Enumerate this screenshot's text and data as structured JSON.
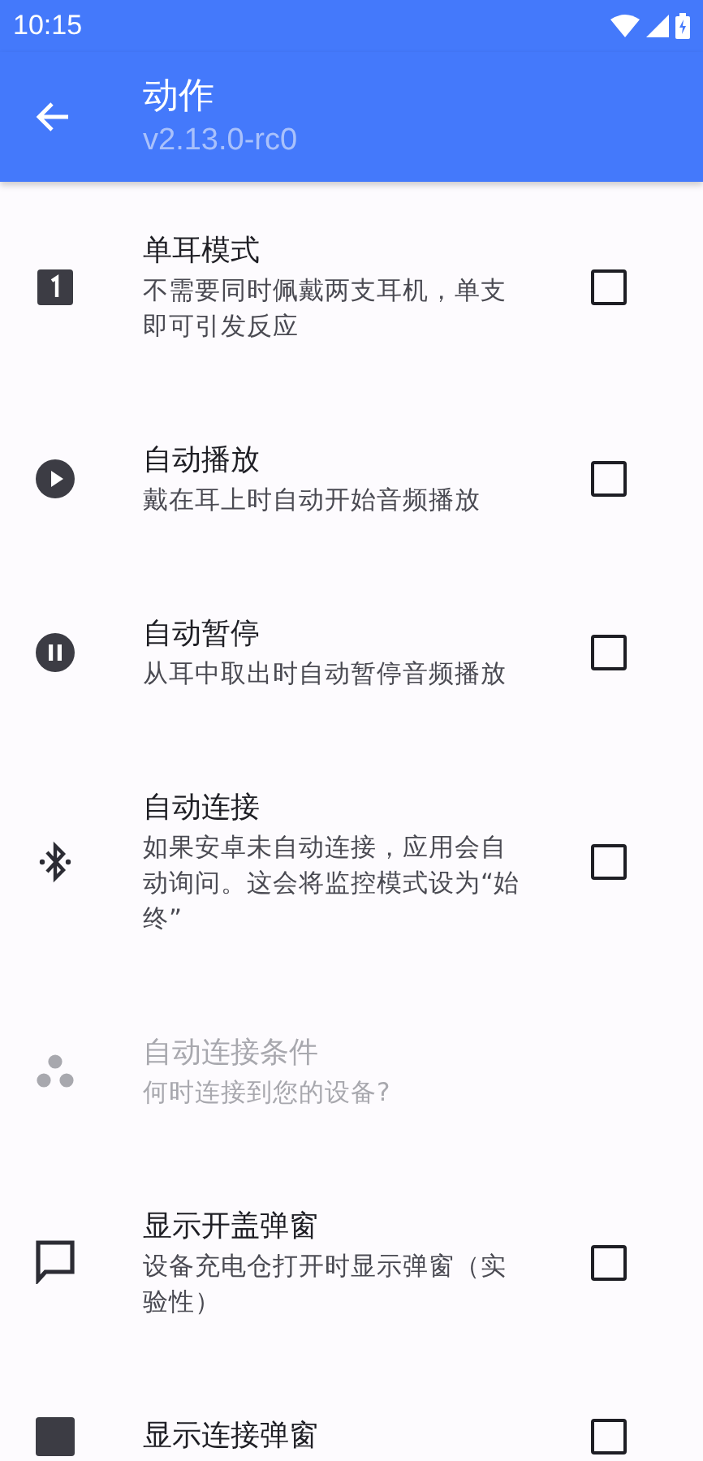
{
  "status_bar": {
    "time": "10:15"
  },
  "app_bar": {
    "title": "动作",
    "subtitle": "v2.13.0-rc0"
  },
  "items": [
    {
      "kind": "checkbox",
      "title": "单耳模式",
      "summary": "不需要同时佩戴两支耳机，单支即可引发反应",
      "checked": false,
      "disabled": false
    },
    {
      "kind": "checkbox",
      "title": "自动播放",
      "summary": "戴在耳上时自动开始音频播放",
      "checked": false,
      "disabled": false
    },
    {
      "kind": "checkbox",
      "title": "自动暂停",
      "summary": "从耳中取出时自动暂停音频播放",
      "checked": false,
      "disabled": false
    },
    {
      "kind": "checkbox",
      "title": "自动连接",
      "summary": "如果安卓未自动连接，应用会自动询问。这会将监控模式设为“始终”",
      "checked": false,
      "disabled": false
    },
    {
      "kind": "link",
      "title": "自动连接条件",
      "summary": "何时连接到您的设备?",
      "disabled": true
    },
    {
      "kind": "checkbox",
      "title": "显示开盖弹窗",
      "summary": "设备充电仓打开时显示弹窗（实验性）",
      "checked": false,
      "disabled": false
    },
    {
      "kind": "checkbox",
      "title": "显示连接弹窗",
      "checked": false,
      "disabled": false
    }
  ]
}
